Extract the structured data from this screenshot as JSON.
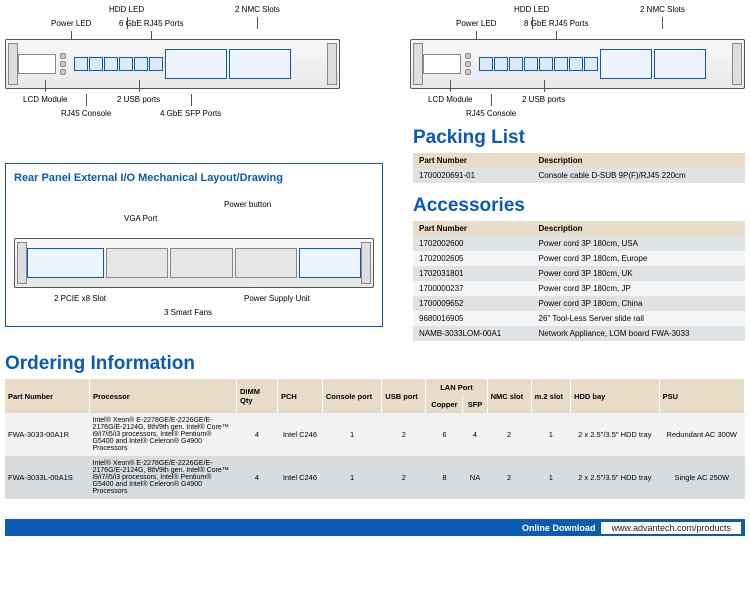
{
  "frontA": {
    "top": [
      "Power LED",
      "HDD LED",
      "6 GbE RJ45 Ports",
      "2 NMC Slots"
    ],
    "bot": [
      "LCD Module",
      "2 USB ports",
      "RJ45 Console",
      "4 GbE SFP Ports"
    ]
  },
  "frontB": {
    "top": [
      "Power LED",
      "HDD LED",
      "8 GbE RJ45 Ports",
      "2 NMC Slots"
    ],
    "bot": [
      "LCD Module",
      "2 USB ports",
      "RJ45 Console"
    ]
  },
  "rear": {
    "title": "Rear Panel External I/O Mechanical Layout/Drawing",
    "top": [
      "VGA Port",
      "Power button"
    ],
    "bot": [
      "2 PCIE x8 Slot",
      "3 Smart Fans",
      "Power Supply Unit"
    ]
  },
  "packing": {
    "title": "Packing List",
    "head": [
      "Part Number",
      "Description"
    ],
    "rows": [
      [
        "1700020691-01",
        "Console cable D-SUB 9P(F)/RJ45 220cm"
      ]
    ]
  },
  "acc": {
    "title": "Accessories",
    "head": [
      "Part Number",
      "Description"
    ],
    "rows": [
      [
        "1702002600",
        "Power cord 3P 180cm, USA"
      ],
      [
        "1702002605",
        "Power cord 3P 180cm, Europe"
      ],
      [
        "1702031801",
        "Power cord 3P 180cm, UK"
      ],
      [
        "1700000237",
        "Power cord 3P 180cm, JP"
      ],
      [
        "1700009652",
        "Power cord 3P 180cm, China"
      ],
      [
        "9680016905",
        "26\" Tool-Less Server slide rail"
      ],
      [
        "NAMB-3033LOM-00A1",
        "Network Appliance, LOM board FWA-3033"
      ]
    ]
  },
  "order": {
    "title": "Ordering Information",
    "head": [
      "Part Number",
      "Processor",
      "DIMM Qty",
      "PCH",
      "Console port",
      "USB port",
      "LAN Port",
      "NMC slot",
      "m.2 slot",
      "HDD bay",
      "PSU"
    ],
    "lansub": [
      "Copper",
      "SFP"
    ],
    "rows": [
      {
        "pn": "FWA-3033-00A1R",
        "proc": "Intel® Xeon® E-2278GE/E-2226GE/E-2176G/E-2124G, 8th/9th gen. Intel® Core™ i9/i7/i5/i3 processors, Intel® Pentium® G5400 and Intel® Celeron® G4900 Processors",
        "dimm": "4",
        "pch": "Intel C246",
        "con": "1",
        "usb": "2",
        "cu": "6",
        "sfp": "4",
        "nmc": "2",
        "m2": "1",
        "hdd": "2 x 2.5\"/3.5\" HDD tray",
        "psu": "Redundant AC 300W"
      },
      {
        "pn": "FWA-3033L-00A1S",
        "proc": "Intel® Xeon® E-2278GE/E-2226GE/E-2176G/E-2124G, 8th/9th gen. Intel® Core™ i9/i7/i5/i3 processors, Intel® Pentium® G5400 and Intel® Celeron® G4900 Processors",
        "dimm": "4",
        "pch": "Intel C246",
        "con": "1",
        "usb": "2",
        "cu": "8",
        "sfp": "NA",
        "nmc": "2",
        "m2": "1",
        "hdd": "2 x 2.5\"/3.5\" HDD tray",
        "psu": "Single AC 250W"
      }
    ]
  },
  "footer": {
    "label": "Online Download",
    "url": "www.advantech.com/products"
  }
}
